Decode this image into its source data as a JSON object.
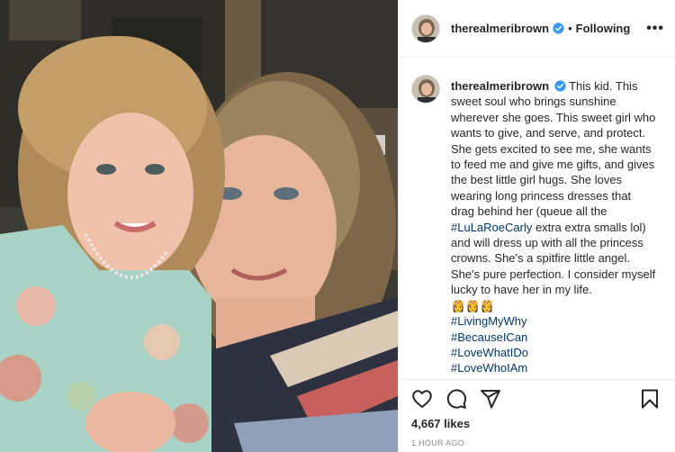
{
  "post": {
    "username": "therealmeribrown",
    "follow_status": "Following",
    "more_label": "•••",
    "caption": {
      "username": "therealmeribrown",
      "text_1": "This kid. This sweet soul who brings sunshine wherever she goes. This sweet girl who wants to give, and serve, and protect. She gets excited to see me, she wants to feed me and give me gifts, and gives the best little girl hugs. She loves wearing long princess dresses that drag behind her (queue all the ",
      "inline_hashtag": "#LuLaRoeCarly",
      "text_2": " extra extra smalls lol) and will dress up with all the princess crowns. She's a spitfire little angel. She's pure perfection. I consider myself lucky to have her in my life.",
      "emojis": "👸👸👸",
      "hashtags": [
        "#LivingMyWhy",
        "#BecauseICan",
        "#LoveWhatIDo",
        "#LoveWhoIAm"
      ]
    },
    "likes": "4,667 likes",
    "timestamp": "1 HOUR AGO"
  },
  "icons": {
    "verified": "verified-badge-icon",
    "like": "heart-icon",
    "comment": "comment-icon",
    "share": "paper-plane-icon",
    "save": "bookmark-icon"
  },
  "colors": {
    "verified": "#3897f0",
    "hashtag": "#00376b",
    "text": "#262626",
    "muted": "#8e8e8e"
  }
}
